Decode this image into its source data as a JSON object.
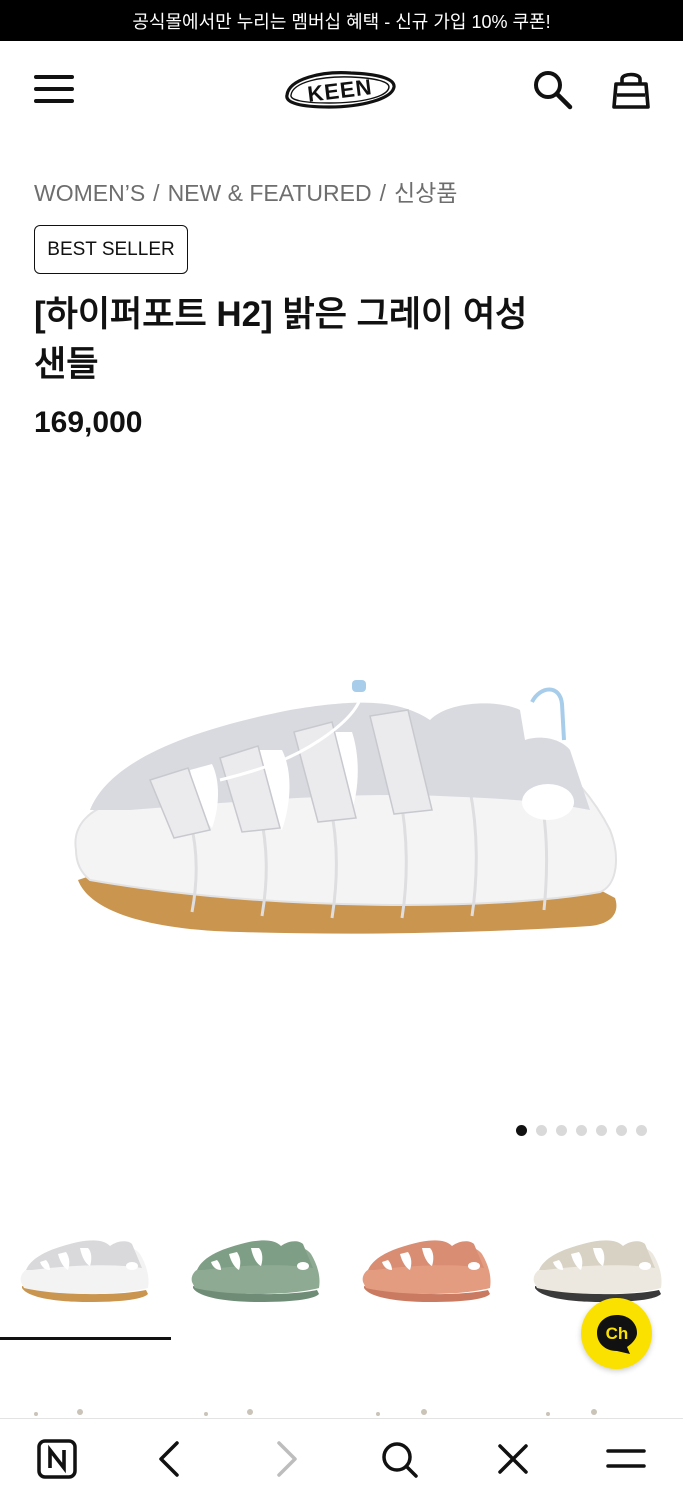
{
  "promo": {
    "text": "공식몰에서만 누리는 멤버십 혜택 - 신규 가입 10% 쿠폰!"
  },
  "header": {
    "logo_text": "KEEN"
  },
  "breadcrumb": {
    "items": [
      "WOMEN’S",
      "NEW & FEATURED",
      "신상품"
    ],
    "separator": "/"
  },
  "product": {
    "badge": "BEST SELLER",
    "title_line1": "[하이퍼포트 H2] 밝은 그레이 여성",
    "title_line2": "샌들",
    "price": "169,000"
  },
  "gallery": {
    "total_slides": 7,
    "active_index": 0
  },
  "colors": {
    "swatches": [
      {
        "name": "light-gray",
        "upper": "#d9d9dc",
        "sole": "#f3f3f3",
        "outsole": "#c9954f"
      },
      {
        "name": "green",
        "upper": "#7f9e86",
        "sole": "#8faa93",
        "outsole": "#6f8c76"
      },
      {
        "name": "coral",
        "upper": "#d98d72",
        "sole": "#e39c80",
        "outsole": "#c97a60"
      },
      {
        "name": "beige",
        "upper": "#d8d2c5",
        "sole": "#ece8df",
        "outsole": "#3a3a3a"
      }
    ],
    "selected_index": 0
  },
  "chat": {
    "label": "Ch",
    "color": "#fae100"
  },
  "theme": {
    "accent": "#111111",
    "muted": "#6e6e6e",
    "lace_blue": "#a8cdea",
    "gum": "#c9954f"
  }
}
